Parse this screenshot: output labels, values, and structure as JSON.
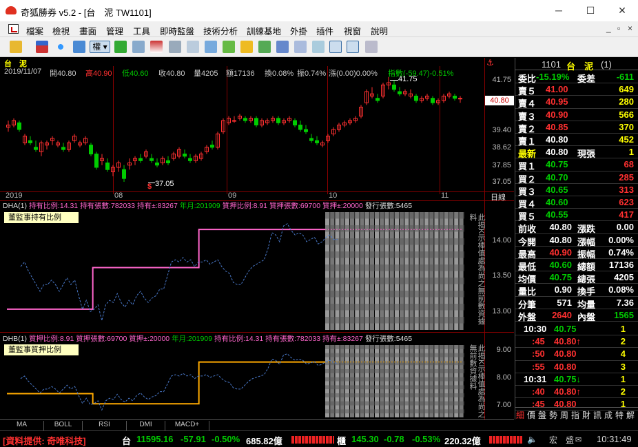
{
  "window": {
    "title": "奇狐勝券 v5.2 - [台　泥 TW1101]",
    "minimize": "─",
    "maximize": "☐",
    "close": "✕"
  },
  "menu": {
    "items": [
      "檔案",
      "檢視",
      "畫面",
      "管理",
      "工具",
      "即時監盤",
      "技術分析",
      "訓練基地",
      "外掛",
      "插件",
      "視窗",
      "說明"
    ],
    "mdi_min": "_",
    "mdi_restore": "▫",
    "mdi_close": "×"
  },
  "toolbar": {
    "icons": [
      "open-folder-icon",
      "toolbar-icon-2",
      "crosshair-icon",
      "layout-icon",
      "stock-select-icon",
      "toolbar-icon-6",
      "toolbar-icon-7",
      "toolbar-icon-8",
      "toolbar-icon-9",
      "toolbar-icon-10",
      "toolbar-icon-11",
      "toolbar-icon-12",
      "toolbar-icon-13",
      "toolbar-icon-14",
      "toolbar-icon-15",
      "toolbar-icon-16",
      "toolbar-icon-17",
      "toolbar-icon-18",
      "toolbar-icon-19"
    ],
    "select_label": "權"
  },
  "main_chart": {
    "stock_name": "台　泥",
    "date": "2019/11/07",
    "open": "開40.80",
    "high": "高40.90",
    "low": "低40.60",
    "close": "收40.80",
    "volume": "量4205",
    "amount": "額17136",
    "turnover": "換0.08%",
    "amplitude": "振0.74%",
    "change": "漲(0.00)0.00%",
    "index_label": "指數(-59.47)-0.51%",
    "y_ticks": [
      "41.75",
      "40.80",
      "39.40",
      "38.62",
      "37.85",
      "37.05"
    ],
    "current_price": "40.80",
    "max_label": "41.75",
    "min_label": "37.05",
    "signal_mark": "$",
    "x_ticks": [
      "2019",
      "08",
      "09",
      "10",
      "11"
    ],
    "period": "日線"
  },
  "dha": {
    "header": [
      "DHA(1)",
      "持有比例:14.31",
      "持有張數:782033",
      "持有±:83267",
      "年月:201909",
      "質押比例:8.91",
      "質押張數:69700",
      "質押±:20000",
      "發行張數:5465"
    ],
    "legend": "董監事持有比例",
    "y_ticks": [
      "14.00",
      "13.50",
      "13.00"
    ],
    "note": "此揭K示棒值處為尚之無前數資據料"
  },
  "dhb": {
    "header": [
      "DHB(1)",
      "質押比例:8.91",
      "質押張數:69700",
      "質押±:20000",
      "年月:201909",
      "持有比例:14.31",
      "持有張數:782033",
      "持有±:83267",
      "發行張數:5465"
    ],
    "legend": "董監事質押比例",
    "y_ticks": [
      "9.00",
      "8.00",
      "7.00"
    ],
    "note": "此揭K示棒值處為尚之無前數資據料"
  },
  "bottom_tabs": [
    "MA",
    "BOLL",
    "RSI",
    "DMI",
    "MACD+"
  ],
  "chart_data": [
    {
      "type": "candlestick",
      "title": "台　泥",
      "series": [
        {
          "name": "price",
          "values": [
            [
              39.5,
              39.8,
              39.3,
              39.6
            ],
            [
              39.6,
              39.9,
              39.5,
              39.8
            ],
            [
              39.7,
              39.8,
              39.3,
              39.4
            ],
            [
              38.8,
              39.2,
              38.7,
              39.1
            ],
            [
              38.9,
              39.1,
              38.7,
              38.8
            ],
            [
              38.6,
              38.9,
              38.4,
              38.5
            ],
            [
              38.4,
              38.9,
              38.2,
              38.8
            ],
            [
              38.7,
              38.9,
              38.5,
              38.8
            ],
            [
              38.9,
              39.1,
              38.7,
              39.0
            ],
            [
              38.7,
              38.9,
              38.6,
              38.8
            ],
            [
              38.6,
              38.8,
              38.4,
              38.5
            ],
            [
              38.5,
              38.9,
              38.4,
              38.8
            ],
            [
              38.9,
              39.2,
              38.8,
              39.1
            ],
            [
              38.7,
              38.9,
              38.6,
              38.8
            ],
            [
              38.8,
              39.1,
              38.7,
              39.0
            ],
            [
              38.7,
              38.8,
              38.2,
              38.3
            ],
            [
              38.3,
              38.4,
              37.6,
              37.7
            ],
            [
              38.0,
              38.3,
              37.8,
              38.1
            ],
            [
              37.9,
              38.1,
              37.5,
              37.6
            ],
            [
              37.5,
              37.8,
              37.3,
              37.7
            ],
            [
              37.7,
              38.0,
              37.5,
              37.9
            ],
            [
              37.6,
              37.8,
              37.05,
              37.2
            ],
            [
              37.8,
              38.1,
              37.6,
              37.9
            ],
            [
              38.0,
              38.2,
              37.8,
              38.1
            ],
            [
              38.1,
              38.3,
              37.9,
              38.0
            ],
            [
              38.2,
              38.5,
              38.1,
              38.4
            ],
            [
              38.1,
              38.3,
              37.9,
              38.0
            ],
            [
              37.9,
              38.1,
              37.7,
              37.8
            ],
            [
              37.9,
              38.2,
              37.8,
              38.1
            ],
            [
              38.0,
              38.2,
              37.8,
              37.9
            ],
            [
              38.1,
              38.4,
              38.0,
              38.3
            ],
            [
              38.2,
              38.6,
              38.1,
              38.5
            ],
            [
              38.3,
              38.5,
              38.1,
              38.2
            ],
            [
              38.1,
              38.3,
              37.9,
              38.0
            ],
            [
              38.0,
              38.3,
              37.9,
              38.2
            ],
            [
              38.1,
              38.4,
              38.0,
              38.3
            ],
            [
              38.4,
              38.7,
              38.3,
              38.6
            ],
            [
              38.7,
              38.9,
              38.5,
              38.6
            ],
            [
              38.6,
              39.3,
              38.5,
              39.2
            ],
            [
              39.3,
              39.9,
              39.2,
              39.8
            ],
            [
              39.7,
              40.0,
              39.6,
              39.9
            ],
            [
              39.8,
              40.0,
              39.7,
              39.8
            ],
            [
              39.9,
              40.1,
              39.8,
              40.0
            ],
            [
              39.9,
              40.0,
              39.7,
              39.8
            ],
            [
              39.8,
              40.0,
              39.7,
              39.9
            ],
            [
              39.9,
              40.0,
              39.5,
              39.6
            ],
            [
              39.6,
              39.9,
              39.5,
              39.8
            ],
            [
              39.7,
              39.9,
              39.6,
              39.8
            ],
            [
              39.8,
              40.0,
              39.7,
              39.9
            ],
            [
              39.9,
              40.0,
              39.6,
              39.7
            ],
            [
              39.7,
              39.9,
              39.6,
              39.8
            ],
            [
              39.8,
              40.0,
              39.7,
              39.9
            ],
            [
              39.8,
              39.9,
              39.5,
              39.6
            ],
            [
              39.6,
              39.8,
              39.3,
              39.4
            ],
            [
              39.4,
              39.6,
              39.2,
              39.3
            ],
            [
              39.0,
              39.2,
              38.8,
              38.9
            ],
            [
              38.9,
              39.1,
              38.7,
              38.8
            ],
            [
              38.7,
              38.9,
              38.6,
              38.8
            ],
            [
              38.9,
              39.2,
              38.8,
              39.1
            ],
            [
              39.2,
              39.5,
              39.1,
              39.4
            ],
            [
              39.4,
              39.7,
              39.3,
              39.6
            ],
            [
              39.6,
              39.8,
              39.5,
              39.7
            ],
            [
              39.7,
              39.9,
              39.6,
              39.8
            ],
            [
              39.8,
              40.0,
              39.7,
              39.9
            ],
            [
              40.0,
              40.5,
              39.9,
              40.4
            ],
            [
              40.6,
              41.2,
              40.5,
              41.1
            ],
            [
              40.9,
              41.3,
              40.8,
              41.0
            ],
            [
              40.8,
              41.0,
              40.6,
              40.7
            ],
            [
              40.9,
              41.5,
              40.8,
              41.4
            ],
            [
              41.4,
              41.75,
              41.2,
              41.5
            ],
            [
              41.4,
              41.6,
              41.1,
              41.2
            ],
            [
              41.1,
              41.3,
              40.9,
              41.0
            ],
            [
              41.0,
              41.2,
              40.9,
              41.1
            ],
            [
              40.9,
              41.2,
              40.8,
              41.0
            ],
            [
              40.9,
              41.0,
              40.6,
              40.7
            ],
            [
              40.7,
              40.9,
              40.6,
              40.8
            ],
            [
              40.8,
              41.0,
              40.7,
              40.9
            ],
            [
              40.8,
              40.9,
              40.5,
              40.6
            ],
            [
              40.6,
              40.8,
              40.5,
              40.7
            ],
            [
              40.7,
              41.0,
              40.6,
              40.9
            ],
            [
              40.9,
              41.1,
              40.8,
              41.0
            ],
            [
              40.9,
              41.0,
              40.7,
              40.8
            ],
            [
              40.8,
              40.9,
              40.6,
              40.8
            ]
          ]
        }
      ],
      "ylim": [
        37.05,
        41.75
      ]
    },
    {
      "type": "line",
      "title": "董監事持有比例",
      "series": [
        {
          "name": "董監事持有比例",
          "values": [
            13.0,
            13.0,
            13.0,
            13.0,
            13.0,
            13.0,
            13.0,
            13.0,
            13.0,
            13.0,
            13.0,
            13.0,
            13.0,
            13.0,
            13.0,
            13.0,
            13.0,
            13.6,
            13.6,
            13.6,
            13.6,
            13.6,
            13.6,
            13.6,
            13.6,
            13.6,
            13.6,
            13.6,
            13.6,
            13.6,
            13.6,
            13.6,
            13.6,
            13.6,
            13.6,
            13.6,
            13.6,
            13.6,
            14.15,
            14.15,
            14.15,
            14.15,
            14.15,
            14.15,
            14.15,
            14.15,
            14.15,
            14.15,
            14.15,
            14.15,
            14.15,
            14.15,
            14.15,
            14.15,
            14.15,
            14.15,
            14.15,
            14.15,
            14.15,
            14.15,
            14.15,
            14.15,
            14.15,
            14.15
          ]
        }
      ],
      "ylim": [
        12.75,
        14.35
      ]
    },
    {
      "type": "line",
      "title": "董監事質押比例",
      "series": [
        {
          "name": "董監事質押比例",
          "values": [
            7.5,
            7.5,
            7.5,
            7.5,
            7.5,
            7.5,
            7.5,
            7.5,
            7.5,
            7.5,
            7.5,
            7.5,
            7.5,
            7.5,
            7.5,
            7.5,
            7.5,
            7.05,
            7.05,
            7.05,
            7.05,
            7.05,
            7.05,
            7.05,
            7.05,
            7.05,
            7.05,
            7.05,
            7.05,
            7.05,
            7.05,
            7.05,
            7.05,
            7.05,
            7.05,
            7.05,
            7.05,
            7.05,
            8.9,
            8.9,
            8.9,
            8.9,
            8.9,
            8.9,
            8.9,
            8.9,
            8.9,
            8.9,
            8.9,
            8.9,
            8.9,
            8.9,
            8.9,
            8.9,
            8.9,
            8.9,
            8.9,
            8.9,
            8.9,
            8.9,
            8.9,
            8.9,
            8.9,
            8.9
          ]
        }
      ],
      "ylim": [
        6.6,
        9.5
      ]
    }
  ],
  "quote": {
    "code": "1101",
    "name": "台　泥",
    "badge": "(1)",
    "bidask_label": "委比",
    "bidask_ratio": "-15.19%",
    "diff_label": "委差",
    "diff": "-611",
    "asks": [
      {
        "label": "賣５",
        "price": "41.00",
        "vol": "649"
      },
      {
        "label": "賣４",
        "price": "40.95",
        "vol": "280"
      },
      {
        "label": "賣３",
        "price": "40.90",
        "vol": "566"
      },
      {
        "label": "賣２",
        "price": "40.85",
        "vol": "370"
      },
      {
        "label": "賣１",
        "price": "40.80",
        "vol": "452"
      }
    ],
    "last_label": "最新",
    "last": "40.80",
    "cur_label": "現張",
    "cur": "1",
    "bids": [
      {
        "label": "買１",
        "price": "40.75",
        "vol": "68"
      },
      {
        "label": "買２",
        "price": "40.70",
        "vol": "285"
      },
      {
        "label": "買３",
        "price": "40.65",
        "vol": "313"
      },
      {
        "label": "買４",
        "price": "40.60",
        "vol": "623"
      },
      {
        "label": "買５",
        "price": "40.55",
        "vol": "417"
      }
    ],
    "stats": [
      {
        "l1": "前收",
        "v1": "40.80",
        "l2": "漲跌",
        "v2": "0.00"
      },
      {
        "l1": "今開",
        "v1": "40.80",
        "l2": "漲幅",
        "v2": "0.00%"
      },
      {
        "l1": "最高",
        "v1": "40.90",
        "l2": "振幅",
        "v2": "0.74%"
      },
      {
        "l1": "最低",
        "v1": "40.60",
        "l2": "總額",
        "v2": "17136"
      },
      {
        "l1": "均價",
        "v1": "40.75",
        "l2": "總張",
        "v2": "4205"
      },
      {
        "l1": "量比",
        "v1": "0.90",
        "l2": "換手",
        "v2": "0.08%"
      },
      {
        "l1": "分筆",
        "v1": "571",
        "l2": "均量",
        "v2": "7.36"
      },
      {
        "l1": "外盤",
        "v1": "2640",
        "l2": "內盤",
        "v2": "1565"
      }
    ],
    "ticks": [
      {
        "time": "10:30",
        "price": "40.75",
        "vol": "1"
      },
      {
        "time": ":45",
        "price": "40.80↑",
        "vol": "2"
      },
      {
        "time": ":50",
        "price": "40.80",
        "vol": "4"
      },
      {
        "time": ":55",
        "price": "40.80",
        "vol": "3"
      },
      {
        "time": "10:31",
        "price": "40.75↓",
        "vol": "1"
      },
      {
        "time": ":40",
        "price": "40.80↑",
        "vol": "2"
      },
      {
        "time": ":45",
        "price": "40.80",
        "vol": "1"
      }
    ],
    "tabs": [
      "細",
      "價",
      "盤",
      "勢",
      "周",
      "指",
      "財",
      "訊",
      "成",
      "特",
      "解"
    ]
  },
  "status": {
    "provider": "[資料提供: 奇唯科技]",
    "tw_label": "台",
    "tw_index": "11595.16",
    "tw_change": "-57.91",
    "tw_pct": "-0.50%",
    "tw_amount": "685.82億",
    "otc_label": "櫃",
    "otc_index": "145.30",
    "otc_change": "-0.78",
    "otc_pct": "-0.53%",
    "otc_amount": "220.32億",
    "hint": "宏　盛",
    "time": "10:31:49"
  },
  "colors": {
    "up": "#ff3030",
    "down": "#00cc00",
    "yellow": "#ffff00",
    "grid": "#8a0000",
    "pink": "#ff66cc",
    "orange": "#ffaa00",
    "blue": "#4a7acc"
  }
}
